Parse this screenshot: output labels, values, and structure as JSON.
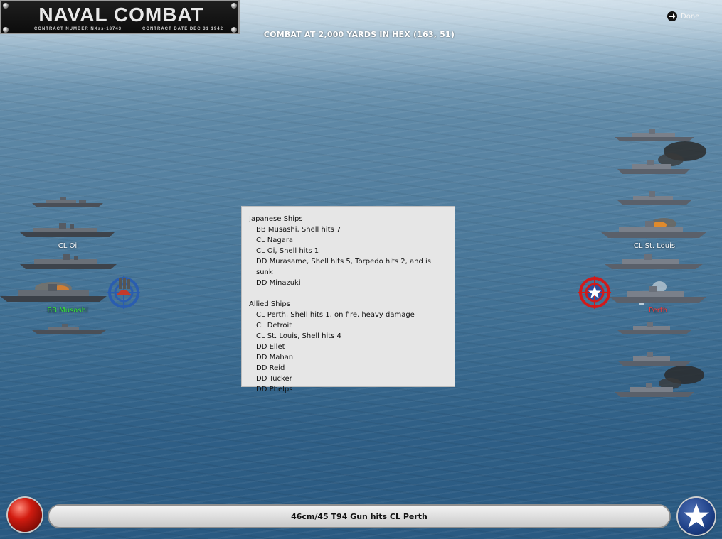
{
  "title_plaque": {
    "title": "NAVAL COMBAT",
    "contract_number": "CONTRACT NUMBER  NXss-18743",
    "contract_date": "CONTRACT DATE  DEC 31 1942"
  },
  "combat_header": "COMBAT AT 2,000 YARDS IN HEX (163, 51)",
  "done_label": "Done",
  "japanese_side": {
    "labels": {
      "cl_oi": "CL Oi",
      "bb_musashi": "BB Musashi"
    }
  },
  "allied_side": {
    "labels": {
      "cl_st_louis": "CL St. Louis",
      "cl_perth": "Perth"
    }
  },
  "report": {
    "japanese_header": "Japanese Ships",
    "japanese_ships": [
      "BB Musashi, Shell hits 7",
      "CL Nagara",
      "CL Oi, Shell hits 1",
      "DD Murasame, Shell hits 5, Torpedo hits 2, and is sunk",
      "DD Minazuki"
    ],
    "allied_header": "Allied Ships",
    "allied_ships": [
      "CL Perth, Shell hits 1,  on fire,  heavy damage",
      "CL Detroit",
      "CL St. Louis, Shell hits 4",
      "DD Ellet",
      "DD Mahan",
      "DD Reid",
      "DD Tucker",
      "DD Phelps"
    ]
  },
  "status_message": "46cm/45 T94 Gun hits CL Perth",
  "colors": {
    "japanese_target_label": "#37e637",
    "allied_target_label": "#ff3a3a",
    "report_bg": "#e6e6e6"
  },
  "icons": {
    "fire_button": "red-orb-icon",
    "allied_roundel": "white-star-icon",
    "done": "arrow-right-icon",
    "japanese_target": "gun-turret-target-icon",
    "allied_target": "star-target-icon"
  }
}
